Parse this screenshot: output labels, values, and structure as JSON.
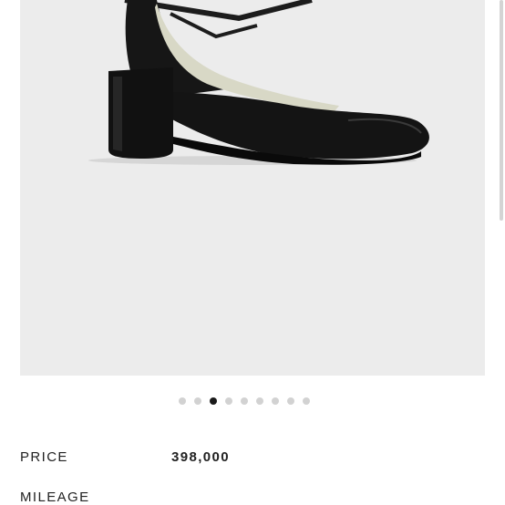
{
  "gallery": {
    "image_alt": "black leather round-toe block heel pump with ankle strap",
    "dot_count": 9,
    "active_index": 2,
    "background_color": "#ececec"
  },
  "product": {
    "price_label": "PRICE",
    "price_value": "398,000",
    "mileage_label": "MILEAGE"
  }
}
